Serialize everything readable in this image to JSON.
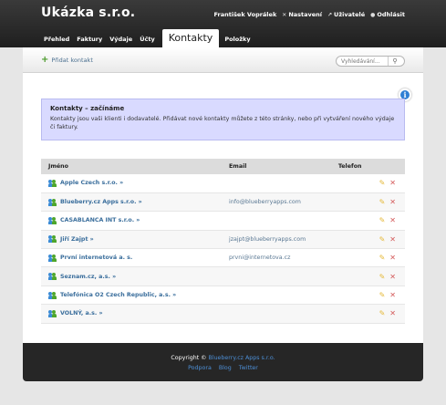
{
  "app": {
    "title": "Ukázka s.r.o."
  },
  "usermenu": {
    "user": "František Voprálek",
    "settings": "Nastavení",
    "users": "Uživatelé",
    "logout": "Odhlásit"
  },
  "nav": {
    "tabs": [
      {
        "label": "Přehled"
      },
      {
        "label": "Faktury"
      },
      {
        "label": "Výdaje"
      },
      {
        "label": "Účty"
      },
      {
        "label": "Kontakty",
        "active": true
      },
      {
        "label": "Položky"
      }
    ]
  },
  "toolbar": {
    "add_label": "Přidat kontakt",
    "search_placeholder": "Vyhledávání..."
  },
  "notice": {
    "title": "Kontakty – začínáme",
    "text": "Kontakty jsou vaši klienti i dodavatelé. Přidávat nové kontakty můžete z této stránky, nebo při vytváření nového výdaje či faktury."
  },
  "table": {
    "headers": {
      "name": "Jméno",
      "email": "Email",
      "phone": "Telefon"
    },
    "rows": [
      {
        "name": "Apple Czech s.r.o. »",
        "email": "",
        "phone": ""
      },
      {
        "name": "Blueberry.cz Apps s.r.o. »",
        "email": "info@blueberryapps.com",
        "phone": ""
      },
      {
        "name": "CASABLANCA INT s.r.o. »",
        "email": "",
        "phone": ""
      },
      {
        "name": "Jiří Zajpt »",
        "email": "jzajpt@blueberryapps.com",
        "phone": ""
      },
      {
        "name": "První internetová a. s.",
        "email": "prvni@internetova.cz",
        "phone": ""
      },
      {
        "name": "Seznam.cz, a.s. »",
        "email": "",
        "phone": ""
      },
      {
        "name": "Telefónica O2 Czech Republic, a.s. »",
        "email": "",
        "phone": ""
      },
      {
        "name": "VOLNÝ, a.s. »",
        "email": "",
        "phone": ""
      }
    ]
  },
  "footer": {
    "copyright_prefix": "Copyright ©",
    "copyright_link": "Blueberry.cz Apps s.r.o.",
    "links": [
      "Podpora",
      "Blog",
      "Twitter"
    ]
  }
}
